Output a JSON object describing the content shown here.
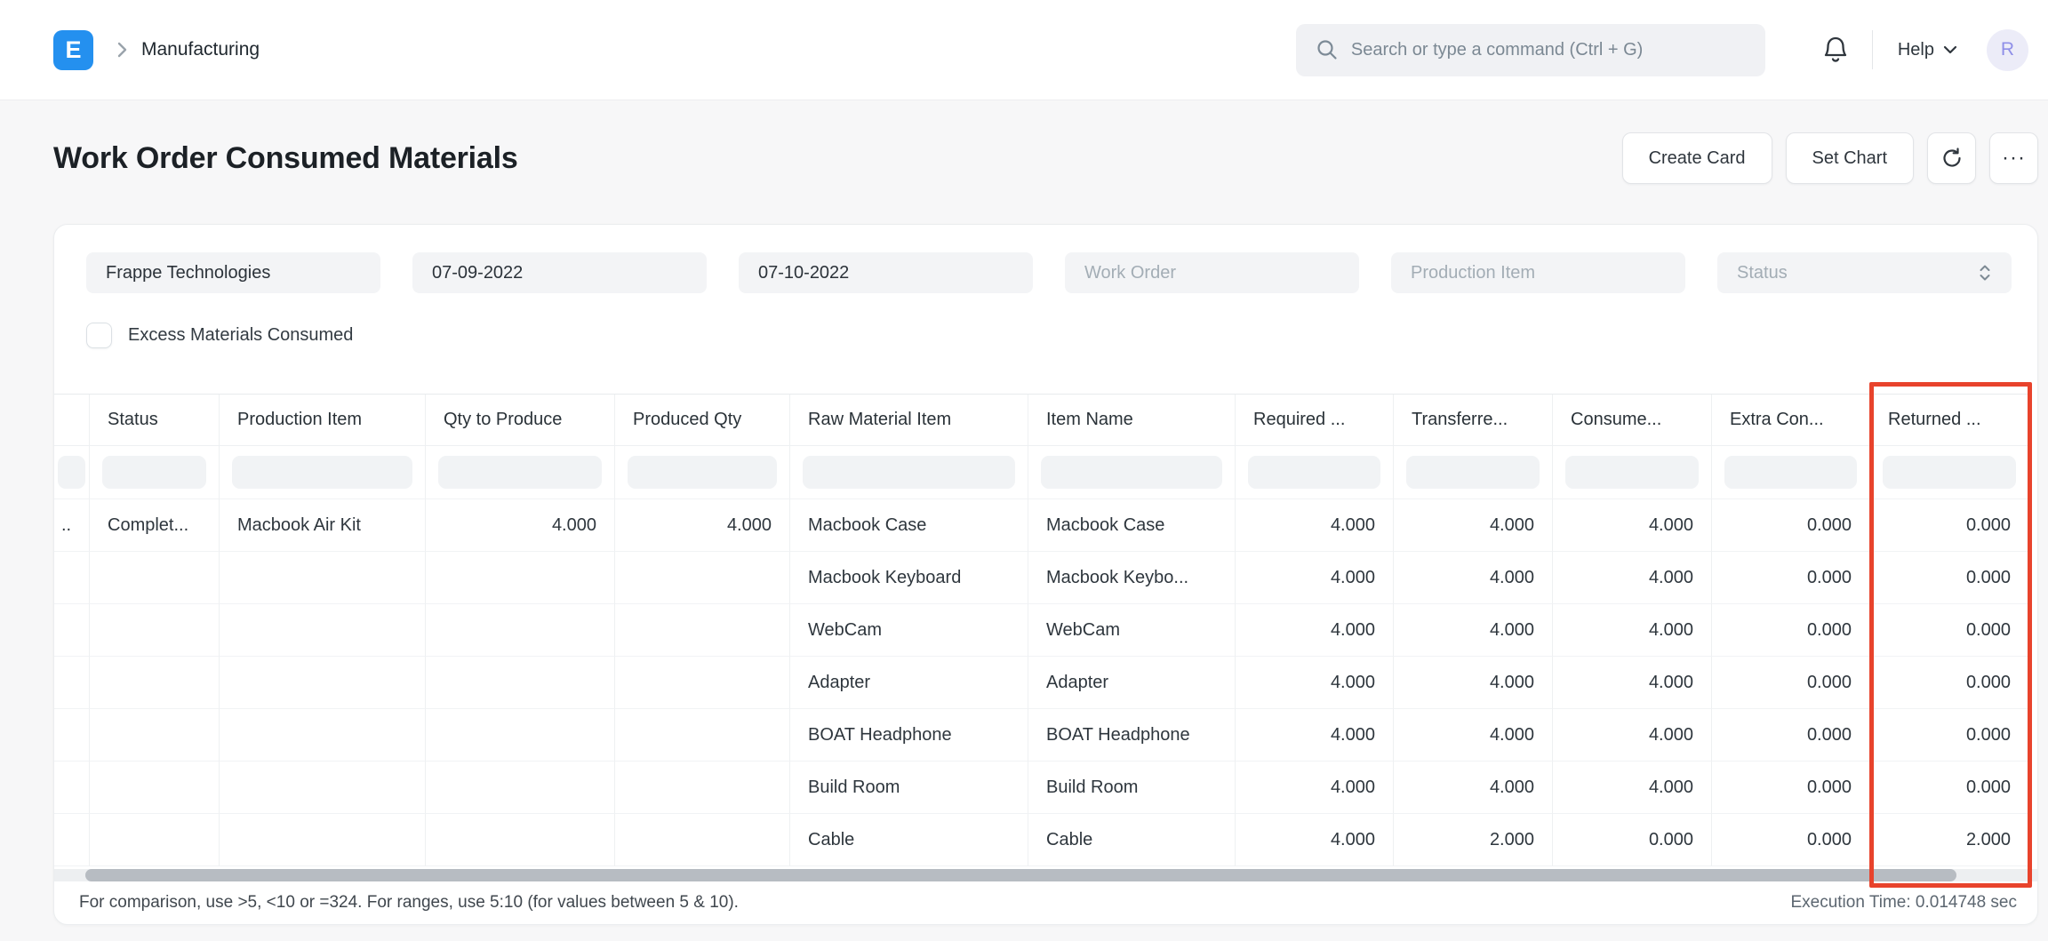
{
  "colors": {
    "brand_blue": "#2490ef",
    "highlight_red": "#e8432c",
    "avatar_bg": "#ececf8",
    "avatar_text": "#8f8fe8"
  },
  "header": {
    "logo_letter": "E",
    "breadcrumb": "Manufacturing",
    "search_placeholder": "Search or type a command (Ctrl + G)",
    "help_label": "Help",
    "avatar_initial": "R"
  },
  "page": {
    "title": "Work Order Consumed Materials",
    "actions": {
      "create_card": "Create Card",
      "set_chart": "Set Chart",
      "ellipsis_glyph": "···"
    }
  },
  "filters": {
    "fields": [
      {
        "name": "company",
        "value": "Frappe Technologies"
      },
      {
        "name": "from-date",
        "value": "07-09-2022"
      },
      {
        "name": "to-date",
        "value": "07-10-2022"
      },
      {
        "name": "work-order",
        "placeholder": "Work Order"
      },
      {
        "name": "production-item",
        "placeholder": "Production Item"
      },
      {
        "name": "status",
        "placeholder": "Status",
        "select": true
      }
    ],
    "excess_label": "Excess Materials Consumed",
    "excess_checked": false
  },
  "table": {
    "columns": [
      "",
      "Status",
      "Production Item",
      "Qty to Produce",
      "Produced Qty",
      "Raw Material Item",
      "Item Name",
      "Required ...",
      "Transferre...",
      "Consume...",
      "Extra Con...",
      "Returned ..."
    ],
    "numeric_columns": [
      3,
      4,
      7,
      8,
      9,
      10,
      11
    ],
    "rows": [
      [
        "..",
        "Complet...",
        "Macbook Air Kit",
        "4.000",
        "4.000",
        "Macbook Case",
        "Macbook Case",
        "4.000",
        "4.000",
        "4.000",
        "0.000",
        "0.000"
      ],
      [
        "",
        "",
        "",
        "",
        "",
        "Macbook Keyboard",
        "Macbook Keybo...",
        "4.000",
        "4.000",
        "4.000",
        "0.000",
        "0.000"
      ],
      [
        "",
        "",
        "",
        "",
        "",
        "WebCam",
        "WebCam",
        "4.000",
        "4.000",
        "4.000",
        "0.000",
        "0.000"
      ],
      [
        "",
        "",
        "",
        "",
        "",
        "Adapter",
        "Adapter",
        "4.000",
        "4.000",
        "4.000",
        "0.000",
        "0.000"
      ],
      [
        "",
        "",
        "",
        "",
        "",
        "BOAT Headphone",
        "BOAT Headphone",
        "4.000",
        "4.000",
        "4.000",
        "0.000",
        "0.000"
      ],
      [
        "",
        "",
        "",
        "",
        "",
        "Build Room",
        "Build Room",
        "4.000",
        "4.000",
        "4.000",
        "0.000",
        "0.000"
      ],
      [
        "",
        "",
        "",
        "",
        "",
        "Cable",
        "Cable",
        "4.000",
        "2.000",
        "0.000",
        "0.000",
        "2.000"
      ]
    ],
    "highlighted_column": "Returned ..."
  },
  "footer": {
    "hint": "For comparison, use >5, <10 or =324. For ranges, use 5:10 (for values between 5 & 10).",
    "execution_time": "Execution Time: 0.014748 sec"
  }
}
